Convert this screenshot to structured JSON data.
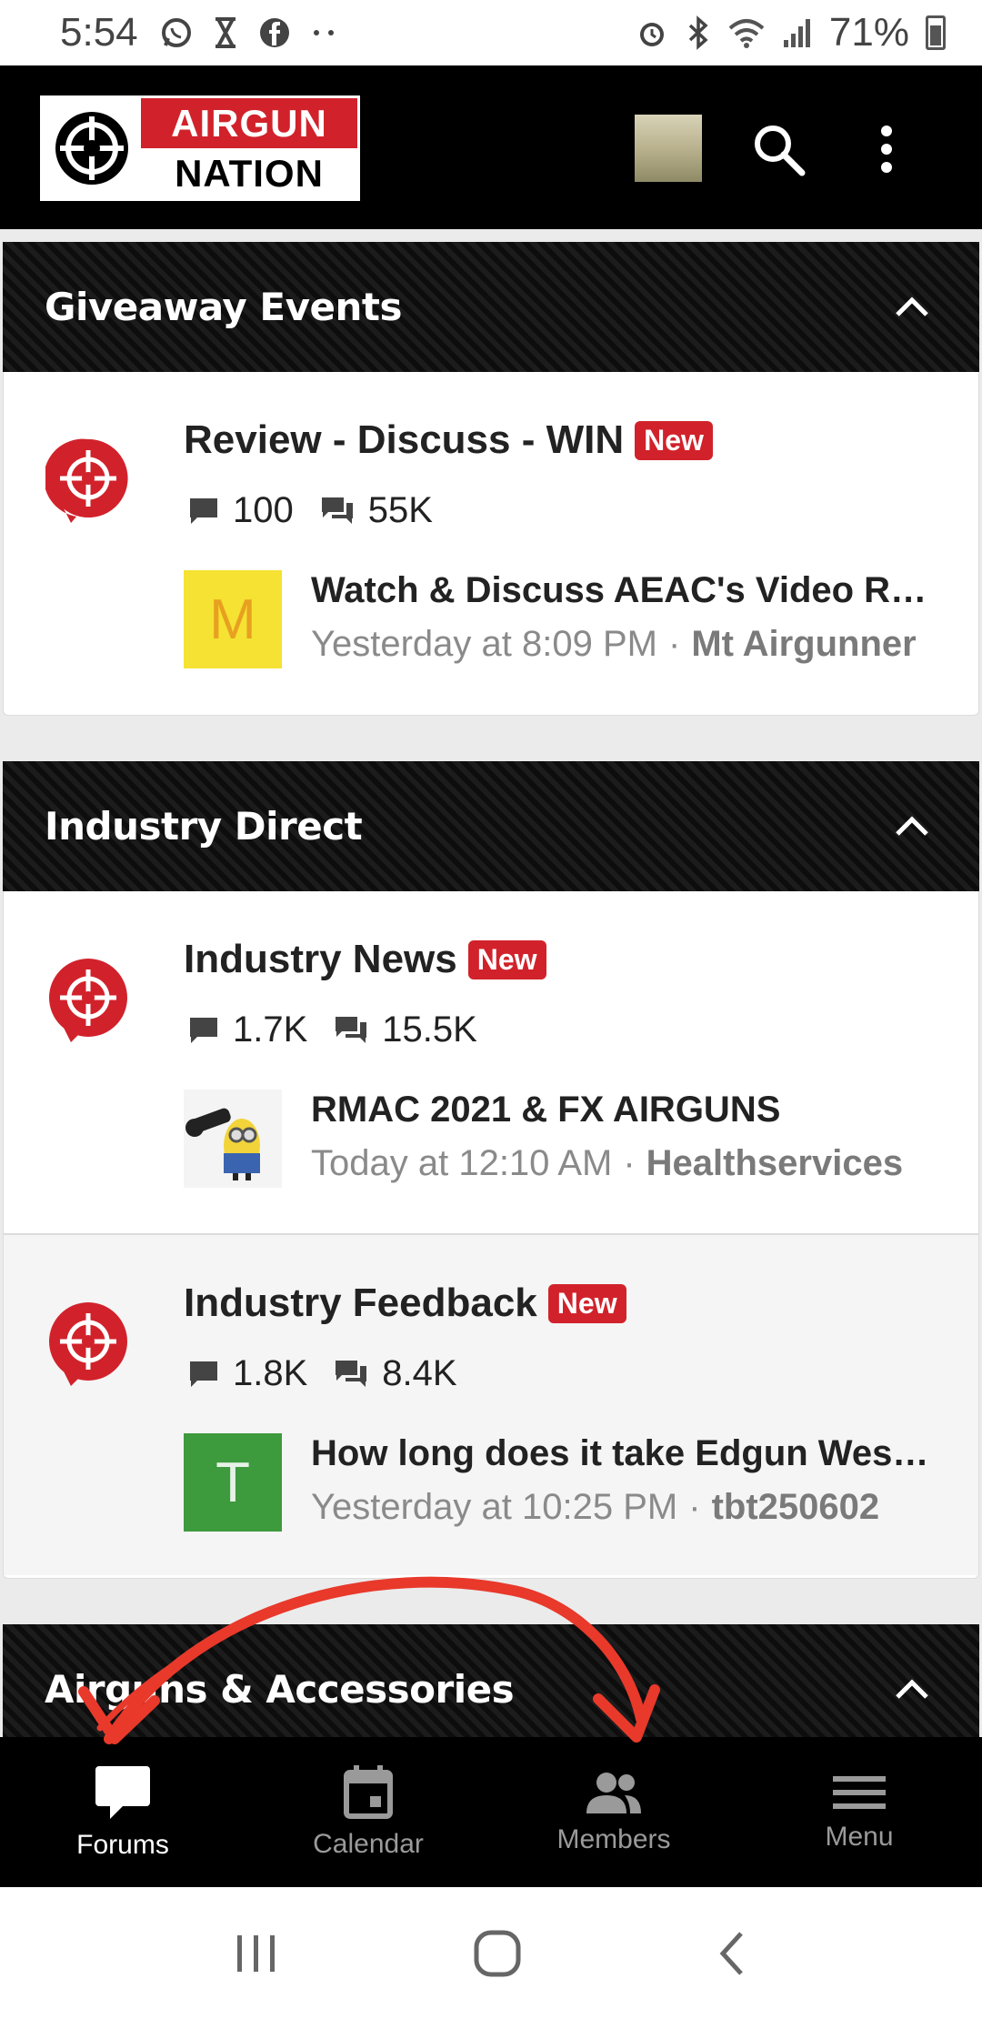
{
  "status_bar": {
    "time": "5:54",
    "battery": "71%",
    "left_icons": [
      "whatsapp-icon",
      "hourglass-icon",
      "facebook-icon",
      "more-dots-icon"
    ],
    "right_icons": [
      "alarm-icon",
      "bluetooth-icon",
      "wifi-icon",
      "signal-icon",
      "battery-icon"
    ]
  },
  "header": {
    "logo_line1": "AIRGUN",
    "logo_line2": "NATION",
    "brand_color": "#d1222b"
  },
  "categories": [
    {
      "title": "Giveaway Events",
      "nodes": [
        {
          "title": "Review - Discuss - WIN",
          "badge": "New",
          "threads": "100",
          "messages": "55K",
          "last_post": {
            "title": "Watch & Discuss AEAC's Video Rev…",
            "time": "Yesterday at 8:09 PM",
            "separator": "·",
            "user": "Mt Airgunner",
            "avatar_letter": "M",
            "avatar_bg": "#f5e232",
            "avatar_fg": "#e8a020"
          }
        }
      ]
    },
    {
      "title": "Industry Direct",
      "nodes": [
        {
          "title": "Industry News",
          "badge": "New",
          "threads": "1.7K",
          "messages": "15.5K",
          "last_post": {
            "title": "RMAC 2021 & FX AIRGUNS",
            "time": "Today at 12:10 AM",
            "separator": "·",
            "user": "Healthservices",
            "avatar_letter": "",
            "avatar_bg": "#f2f2f2",
            "avatar_fg": "#333333"
          }
        },
        {
          "title": "Industry Feedback",
          "badge": "New",
          "threads": "1.8K",
          "messages": "8.4K",
          "last_post": {
            "title": "How long does it take Edgun West t…",
            "time": "Yesterday at 10:25 PM",
            "separator": "·",
            "user": "tbt250602",
            "avatar_letter": "T",
            "avatar_bg": "#3d9a3d",
            "avatar_fg": "#e6f2e6"
          }
        }
      ]
    },
    {
      "title": "Airguns & Accessories",
      "nodes": []
    }
  ],
  "bottom_nav": [
    {
      "label": "Forums",
      "icon": "forums-icon",
      "active": true
    },
    {
      "label": "Calendar",
      "icon": "calendar-icon",
      "active": false
    },
    {
      "label": "Members",
      "icon": "members-icon",
      "active": false
    },
    {
      "label": "Menu",
      "icon": "menu-icon",
      "active": false
    }
  ],
  "system_nav": [
    "recent-apps-icon",
    "home-icon",
    "back-icon"
  ],
  "annotation_color": "#e8392b"
}
